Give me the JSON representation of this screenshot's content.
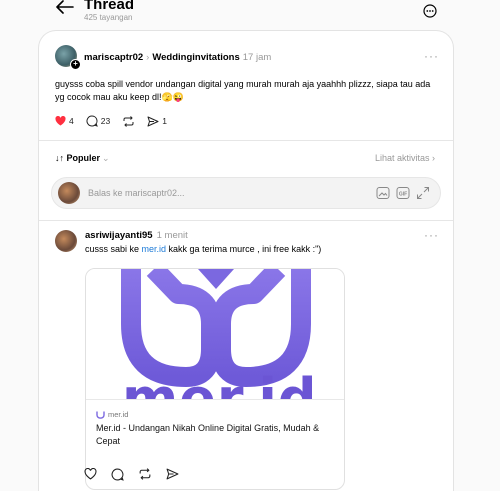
{
  "header": {
    "title": "Thread",
    "views": "425 tayangan"
  },
  "post": {
    "username": "mariscaptr02",
    "community": "Weddinginvitations",
    "time": "17 jam",
    "text": "guysss coba spill vendor undangan digital yang murah murah aja yaahhh plizzz, siapa tau ada yg cocok mau aku keep dl!🫣😜",
    "likes": "4",
    "comments": "23",
    "shares": "1"
  },
  "sort": {
    "label": "Populer",
    "activity_link": "Lihat aktivitas"
  },
  "reply": {
    "placeholder": "Balas ke mariscaptr02..."
  },
  "comment": {
    "username": "asriwijayanti95",
    "time": "1 menit",
    "text_before": "cusss sabi ke ",
    "link": "mer.id",
    "text_after": " kakk ga terima murce , ini free kakk :\")",
    "preview": {
      "image_text": "mer.id",
      "domain": "mer.id",
      "title": "Mer.id - Undangan Nikah Online Digital Gratis, Mudah & Cepat"
    }
  },
  "colors": {
    "like_red": "#ff3040",
    "link_blue": "#1d7bd8",
    "brand_purple": "#7b68e0"
  }
}
